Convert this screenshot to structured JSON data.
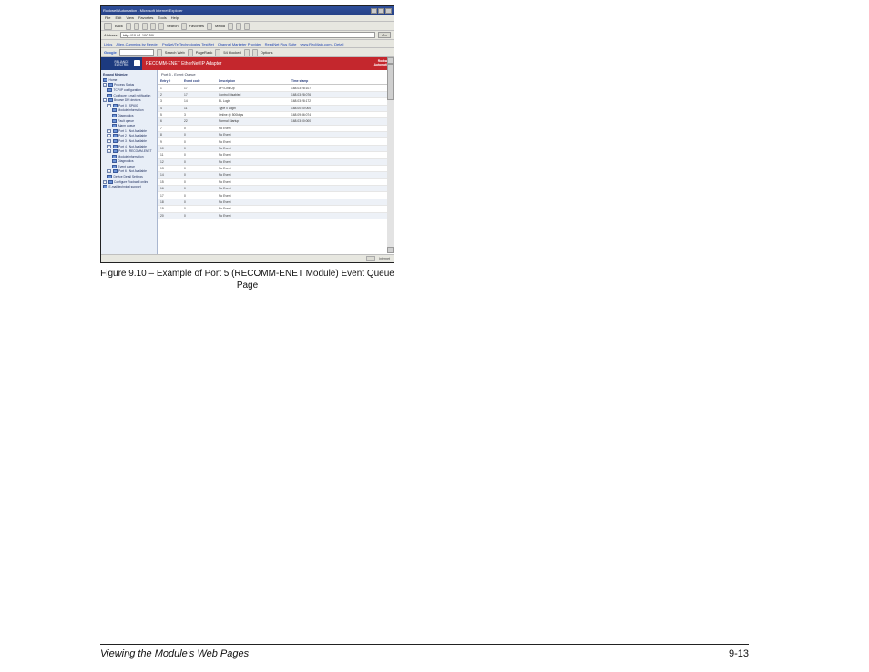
{
  "browser": {
    "title": "Rockwell Automation - Microsoft Internet Explorer",
    "menus": [
      "File",
      "Edit",
      "View",
      "Favorites",
      "Tools",
      "Help"
    ],
    "toolbar": {
      "back": "Back",
      "search": "Search",
      "favorites": "Favorites",
      "media": "Media"
    },
    "address_label": "Address",
    "address_value": "http://10.91.100.50/",
    "go_label": "Go",
    "links_label": "Links",
    "links": [
      "Allen-Cummins by Reeder",
      "ProNet/Te Technologies TestNet",
      "Channel Marketer Provider",
      "ReedNet Plus Suite",
      "www.RecMain.com - Detail"
    ],
    "googlebar": {
      "brand": "Google",
      "search_web": "Search Web",
      "pagerank": "PageRank",
      "blocked": "54 blocked",
      "options": "Options"
    }
  },
  "banner": {
    "brand_line1": "RELIANCE",
    "brand_line2": "ELECTRIC",
    "product": "RECOMM-ENET EtherNet/IP Adapter",
    "corp_line1": "Rockwell",
    "corp_line2": "Automation"
  },
  "sidebar": {
    "header": "Expand   Minimize",
    "nodes": [
      {
        "label": "Home",
        "ind": 0,
        "expandable": false
      },
      {
        "label": "Process Status",
        "ind": 0,
        "expandable": true
      },
      {
        "label": "TCP/IP configuration",
        "ind": 1,
        "expandable": false
      },
      {
        "label": "Configure e-mail notification",
        "ind": 1,
        "expandable": false
      },
      {
        "label": "Browse DPI devices",
        "ind": 0,
        "expandable": true
      },
      {
        "label": "Port 0 - SP600",
        "ind": 1,
        "expandable": true
      },
      {
        "label": "Module information",
        "ind": 2,
        "expandable": false
      },
      {
        "label": "Diagnostics",
        "ind": 2,
        "expandable": false
      },
      {
        "label": "Fault queue",
        "ind": 2,
        "expandable": false
      },
      {
        "label": "Alarm queue",
        "ind": 2,
        "expandable": false
      },
      {
        "label": "Port 1 - Not Available",
        "ind": 1,
        "expandable": true
      },
      {
        "label": "Port 2 - Not Available",
        "ind": 1,
        "expandable": true
      },
      {
        "label": "Port 3 - Not Available",
        "ind": 1,
        "expandable": true
      },
      {
        "label": "Port 4 - Not Available",
        "ind": 1,
        "expandable": true
      },
      {
        "label": "Port 5 - RECOMM-ENET",
        "ind": 1,
        "expandable": true
      },
      {
        "label": "Module information",
        "ind": 2,
        "expandable": false
      },
      {
        "label": "Diagnostics",
        "ind": 2,
        "expandable": false
      },
      {
        "label": "Event queue",
        "ind": 2,
        "expandable": false
      },
      {
        "label": "Port 6 - Not Available",
        "ind": 1,
        "expandable": true
      },
      {
        "label": "Device Detail Settings",
        "ind": 1,
        "expandable": false
      },
      {
        "label": "Configure Rockwell online",
        "ind": 0,
        "expandable": true
      },
      {
        "label": "E-mail technical support",
        "ind": 0,
        "expandable": false
      }
    ]
  },
  "main": {
    "title": "Port 5 - Event Queue",
    "columns": [
      "Entry #",
      "Event code",
      "Description",
      "Time stamp"
    ],
    "rows": [
      {
        "n": "1",
        "code": "17",
        "desc": "DPI Link Up",
        "ts": "168.03:28:107"
      },
      {
        "n": "2",
        "code": "17",
        "desc": "Control Disabled",
        "ts": "168.03:28:076"
      },
      {
        "n": "3",
        "code": "14",
        "desc": "EL Login",
        "ts": "168.03:28:172"
      },
      {
        "n": "4",
        "code": "11",
        "desc": "Type 0 Login",
        "ts": "168.00:00:000"
      },
      {
        "n": "5",
        "code": "3",
        "desc": "Online @ 500kbps",
        "ts": "168.09:36:074"
      },
      {
        "n": "6",
        "code": "22",
        "desc": "Normal Startup",
        "ts": "168.03:00:000"
      },
      {
        "n": "7",
        "code": "0",
        "desc": "No Event",
        "ts": ""
      },
      {
        "n": "8",
        "code": "0",
        "desc": "No Event",
        "ts": ""
      },
      {
        "n": "9",
        "code": "0",
        "desc": "No Event",
        "ts": ""
      },
      {
        "n": "10",
        "code": "0",
        "desc": "No Event",
        "ts": ""
      },
      {
        "n": "11",
        "code": "0",
        "desc": "No Event",
        "ts": ""
      },
      {
        "n": "12",
        "code": "0",
        "desc": "No Event",
        "ts": ""
      },
      {
        "n": "13",
        "code": "0",
        "desc": "No Event",
        "ts": ""
      },
      {
        "n": "14",
        "code": "0",
        "desc": "No Event",
        "ts": ""
      },
      {
        "n": "15",
        "code": "0",
        "desc": "No Event",
        "ts": ""
      },
      {
        "n": "16",
        "code": "0",
        "desc": "No Event",
        "ts": ""
      },
      {
        "n": "17",
        "code": "0",
        "desc": "No Event",
        "ts": ""
      },
      {
        "n": "18",
        "code": "0",
        "desc": "No Event",
        "ts": ""
      },
      {
        "n": "19",
        "code": "0",
        "desc": "No Event",
        "ts": ""
      },
      {
        "n": "20",
        "code": "0",
        "desc": "No Event",
        "ts": ""
      }
    ]
  },
  "statusbar": {
    "zone": "Internet"
  },
  "caption_line1": "Figure 9.10 – Example of Port 5 (RECOMM-ENET Module) Event Queue",
  "caption_line2": "Page",
  "footer": {
    "left": "Viewing the Module's Web Pages",
    "right": "9-13"
  }
}
